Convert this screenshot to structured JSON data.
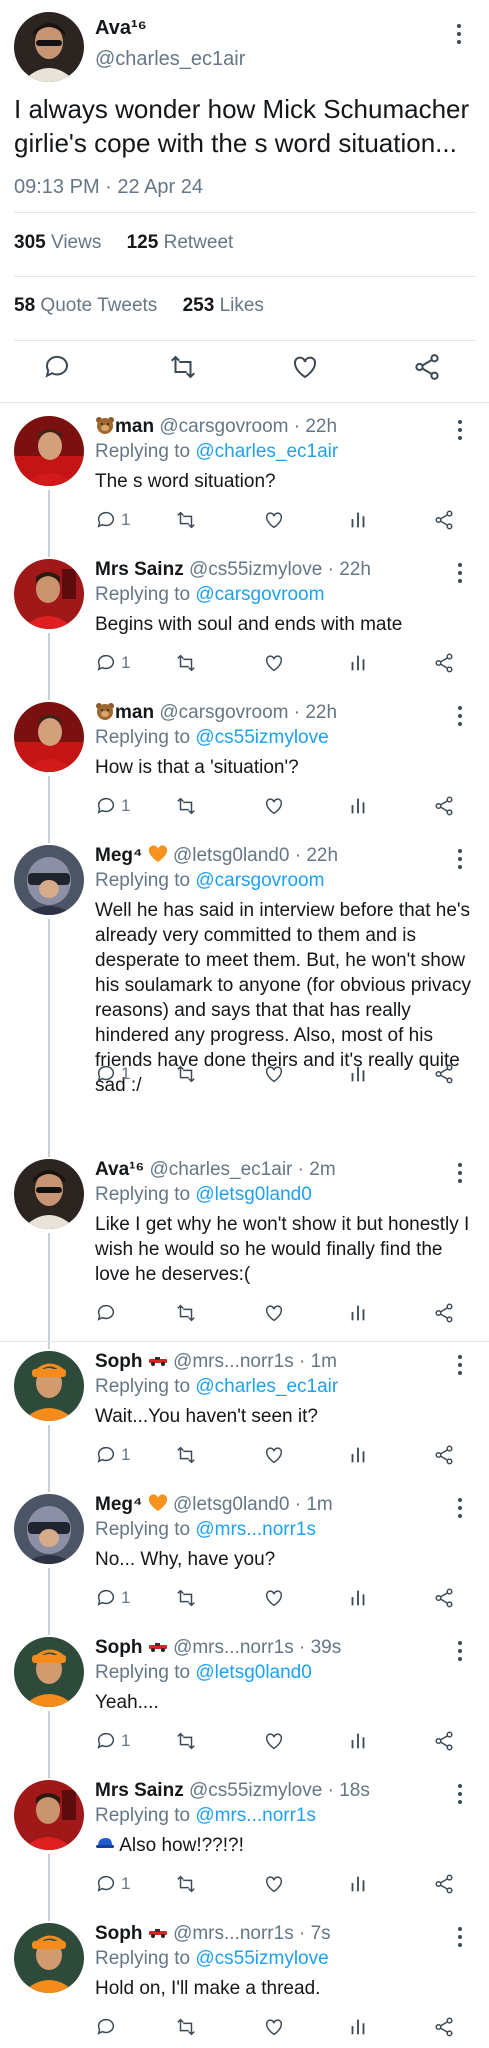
{
  "main_tweet": {
    "name": "Ava¹⁶",
    "handle": "@charles_ec1air",
    "text": "I always wonder how Mick Schumacher girlie's cope with the s word situation...",
    "time": "09:13 PM · 22 Apr 24",
    "views_count": "305",
    "views_label": "Views",
    "retweet_count": "125",
    "retweet_label": "Retweet",
    "quote_count": "58",
    "quote_label": "Quote Tweets",
    "likes_count": "253",
    "likes_label": "Likes"
  },
  "replies": [
    {
      "name": "man",
      "name_emoji": "bear-face-icon",
      "handle": "@carsgovroom · 22h",
      "replying_prefix": "Replying to",
      "replying_to": "@charles_ec1air",
      "text": "The s word situation?",
      "reply_count": "1"
    },
    {
      "name": "Mrs Sainz",
      "handle": "@cs55izmylove · 22h",
      "replying_prefix": "Replying to",
      "replying_to": "@carsgovroom",
      "text": "Begins with soul and ends with mate",
      "reply_count": "1"
    },
    {
      "name": "man",
      "name_emoji": "bear-face-icon",
      "handle": "@carsgovroom · 22h",
      "replying_prefix": "Replying to",
      "replying_to": "@cs55izmylove",
      "text": "How is that a 'situation'?",
      "reply_count": "1"
    },
    {
      "name": "Meg⁴",
      "name_emoji": "orange-heart-icon",
      "handle": "@letsg0land0 · 22h",
      "replying_prefix": "Replying to",
      "replying_to": "@carsgovroom",
      "text": "Well he has said in interview before that he's already very committed to them and is desperate to meet them. But, he won't show his soulamark to anyone (for obvious privacy reasons) and says that that has really hindered any progress. Also, most of his friends have done theirs and it's really quite sad :/",
      "reply_count": "1"
    },
    {
      "name": "Ava¹⁶",
      "handle": "@charles_ec1air · 2m",
      "replying_prefix": "Replying to",
      "replying_to": "@letsg0land0",
      "text": "Like I get why he won't show it but honestly I wish he would so he would finally find the love he deserves:(",
      "reply_count": ""
    },
    {
      "name": "Soph",
      "name_emoji": "race-car-icon",
      "handle": "@mrs...norr1s · 1m",
      "replying_prefix": "Replying to",
      "replying_to": "@charles_ec1air",
      "text": "Wait...You haven't seen it?",
      "reply_count": "1"
    },
    {
      "name": "Meg⁴",
      "name_emoji": "orange-heart-icon",
      "handle": "@letsg0land0 · 1m",
      "replying_prefix": "Replying to",
      "replying_to": "@mrs...norr1s",
      "text": "No... Why, have you?",
      "reply_count": "1"
    },
    {
      "name": "Soph",
      "name_emoji": "race-car-icon",
      "handle": "@mrs...norr1s · 39s",
      "replying_prefix": "Replying to",
      "replying_to": "@letsg0land0",
      "text": "Yeah....",
      "reply_count": "1"
    },
    {
      "name": "Mrs Sainz",
      "handle": "@cs55izmylove · 18s",
      "replying_prefix": "Replying to",
      "replying_to": "@mrs...norr1s",
      "text": "Also how!??!?!",
      "text_emoji": "blue-cap-icon",
      "reply_count": "1"
    },
    {
      "name": "Soph",
      "name_emoji": "race-car-icon",
      "handle": "@mrs...norr1s · 7s",
      "replying_prefix": "Replying to",
      "replying_to": "@cs55izmylove",
      "text": "Hold on, I'll make a thread.",
      "reply_count": ""
    }
  ],
  "colors": {
    "link": "#1da1f2",
    "muted": "#657786",
    "text": "#14171a",
    "divider": "#e1e8ed",
    "thread_line": "#c8d1d8",
    "icon": "#3b4a57"
  }
}
